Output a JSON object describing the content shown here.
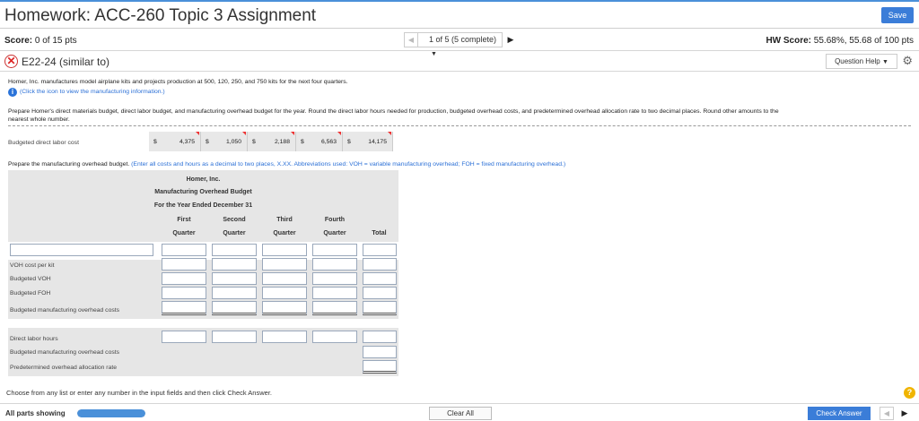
{
  "header": {
    "title": "Homework: ACC-260 Topic 3 Assignment",
    "save_label": "Save"
  },
  "scorebar": {
    "score_label": "Score:",
    "score_value": "0 of 15 pts",
    "question_position": "1 of 5 (5 complete)",
    "hw_score_label": "HW Score:",
    "hw_score_value": "55.68%, 55.68 of 100 pts"
  },
  "question": {
    "label": "E22-24 (similar to)",
    "help_label": "Question Help"
  },
  "body": {
    "intro": "Homer, Inc. manufactures model airplane kits and projects production at 500, 120, 250, and 750 kits for the next four quarters.",
    "info_link": "(Click the icon to view the manufacturing information.)",
    "instructions_1": "Prepare Homer's direct materials budget, direct labor budget, and manufacturing overhead budget for the year. Round the direct labor hours needed for production, budgeted overhead costs, and predetermined overhead allocation rate to two decimal places. Round other amounts to the",
    "instructions_2": "nearest whole number.",
    "budgeted_dl_label": "Budgeted direct labor cost",
    "budgeted_dl_values": [
      "4,375",
      "1,050",
      "2,188",
      "6,563",
      "14,175"
    ],
    "currency": "$",
    "prepare_prefix": "Prepare the manufacturing overhead budget.",
    "prepare_hint": "(Enter all costs and hours as a decimal to two places, X.XX. Abbreviations used: VOH = variable manufacturing overhead; FOH = fixed manufacturing overhead.)"
  },
  "budget": {
    "company": "Homer, Inc.",
    "title": "Manufacturing Overhead Budget",
    "period": "For the Year Ended December 31",
    "columns": [
      {
        "top": "First",
        "bottom": "Quarter"
      },
      {
        "top": "Second",
        "bottom": "Quarter"
      },
      {
        "top": "Third",
        "bottom": "Quarter"
      },
      {
        "top": "Fourth",
        "bottom": "Quarter"
      },
      {
        "top": "",
        "bottom": "Total"
      }
    ],
    "rows": {
      "voh_cost_per_kit": "VOH cost per kit",
      "budgeted_voh": "Budgeted VOH",
      "budgeted_foh": "Budgeted FOH",
      "budgeted_moh": "Budgeted manufacturing overhead costs",
      "direct_labor_hours": "Direct labor hours",
      "budgeted_moh_costs": "Budgeted manufacturing overhead costs",
      "predetermined_rate": "Predetermined overhead allocation rate"
    }
  },
  "footer": {
    "note": "Choose from any list or enter any number in the input fields and then click Check Answer.",
    "all_parts": "All parts showing",
    "clear_all": "Clear All",
    "check_answer": "Check Answer"
  },
  "colors": {
    "accent": "#3b7dd8",
    "incorrect": "#d22222",
    "help": "#f0b400"
  }
}
